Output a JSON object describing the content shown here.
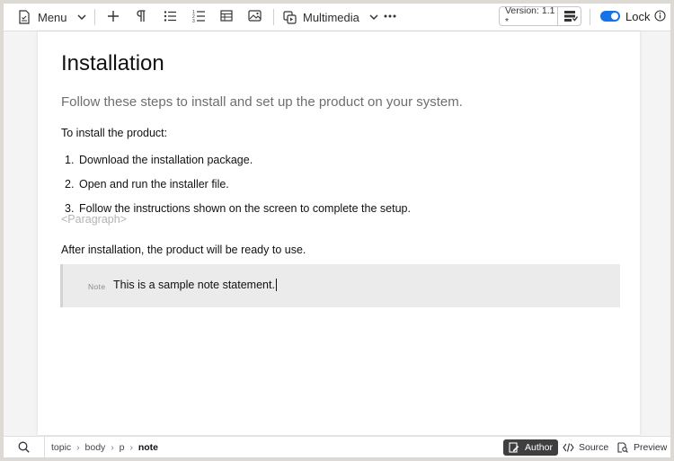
{
  "toolbar": {
    "menu_label": "Menu",
    "multimedia_label": "Multimedia",
    "version_label": "Version: 1.1 *",
    "lock_label": "Lock",
    "accent_color": "#1473e6"
  },
  "document": {
    "title": "Installation",
    "shortdesc": "Follow these steps to install and set up the product on your system.",
    "intro": "To install the product:",
    "steps": [
      {
        "num": "1.",
        "text": "Download the installation package."
      },
      {
        "num": "2.",
        "text": "Open and run the installer file."
      },
      {
        "num": "3.",
        "text": "Follow the instructions shown on the screen to complete the setup."
      }
    ],
    "placeholder": "<Paragraph>",
    "after": "After installation, the product will be ready to use.",
    "note_label": "Note",
    "note_text": "This is a sample note statement."
  },
  "statusbar": {
    "breadcrumb": [
      "topic",
      "body",
      "p",
      "note"
    ],
    "modes": {
      "author": "Author",
      "source": "Source",
      "preview": "Preview"
    },
    "active_mode": "Author"
  }
}
